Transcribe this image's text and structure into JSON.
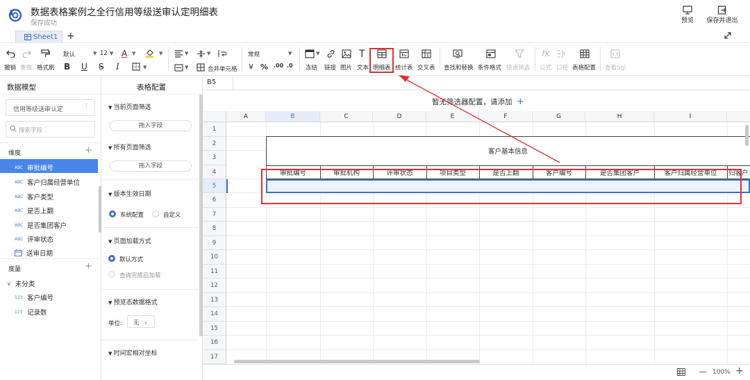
{
  "header": {
    "title": "数据表格案例之全行信用等级送审认定明细表",
    "save_status": "保存成功",
    "preview_label": "预览",
    "save_exit_label": "保存并退出"
  },
  "sheets": {
    "active": "Sheet1"
  },
  "toolbar": {
    "undo": "撤销",
    "redo": "重做",
    "format_painter": "格式刷",
    "font_name": "默认",
    "font_size": "12",
    "bold": "B",
    "underline": "U",
    "strike": "S",
    "italic": "I",
    "merge": "合并单元格",
    "number_format": "常规",
    "currency": "¥",
    "percent": "%",
    "dec_inc": ".00",
    "dec_dec": ".0",
    "freeze": "冻结",
    "link": "链接",
    "image": "图片",
    "text": "文本",
    "detail_table": "明细表",
    "stat_table": "统计表",
    "cross_table": "交叉表",
    "find_replace": "查找和替换",
    "cond_format": "条件格式",
    "quick_filter": "快速筛选",
    "formula": "公式",
    "caliber": "口径",
    "table_config": "表格配置",
    "view_sql": "查看Sql"
  },
  "left_panel": {
    "title": "数据模型",
    "model_select": "信用等级送审认定",
    "search_placeholder": "搜索字段",
    "dimension_label": "维度",
    "dimensions": [
      {
        "type": "ABC",
        "name": "审批编号",
        "selected": true
      },
      {
        "type": "ABC",
        "name": "客户归属经营单位"
      },
      {
        "type": "ABC",
        "name": "客户类型"
      },
      {
        "type": "ABC",
        "name": "是否上翻"
      },
      {
        "type": "ABC",
        "name": "是否集团客户"
      },
      {
        "type": "ABC",
        "name": "评审状态"
      },
      {
        "type": "date",
        "name": "送审日期"
      }
    ],
    "measure_label": "度量",
    "measure_group": "未分类",
    "measures": [
      {
        "type": "123",
        "name": "客户编号"
      },
      {
        "type": "123",
        "name": "记录数"
      }
    ]
  },
  "config_panel": {
    "title": "表格配置",
    "current_filter": "当前页面筛选",
    "drag_field": "拖入字段",
    "all_filter": "所有页面筛选",
    "drag_field2": "拖入字段",
    "version_date": "版本生效日期",
    "opt_system": "系统配置",
    "opt_custom": "自定义",
    "page_load": "页面加载方式",
    "opt_default": "默认方式",
    "opt_after_query": "查询完成后加载",
    "preview_format": "预览态数据格式",
    "unit_label": "单位:",
    "unit_value": "无",
    "time_macro": "时间宏相对坐标"
  },
  "grid": {
    "cell_ref": "B5",
    "filter_notice": "暂无筛选器配置，请添加",
    "columns": [
      "A",
      "B",
      "C",
      "D",
      "E",
      "F",
      "G",
      "H",
      "I"
    ],
    "selected_column": "B",
    "rows": [
      "1",
      "2",
      "3",
      "4",
      "5",
      "6",
      "7",
      "8",
      "9",
      "10",
      "11",
      "12",
      "13",
      "14",
      "15",
      "16",
      "17"
    ],
    "selected_row": "5",
    "title_cell": "客户基本信息",
    "header_cells": [
      "审批编号",
      "审批机构",
      "评审状态",
      "项目类型",
      "是否上翻",
      "客户编号",
      "是否集团客户",
      "客户归属经营单位",
      "归客户"
    ]
  },
  "status": {
    "zoom": "100%"
  },
  "colors": {
    "accent": "#3d6fd4",
    "annotation": "#e02f2f"
  }
}
